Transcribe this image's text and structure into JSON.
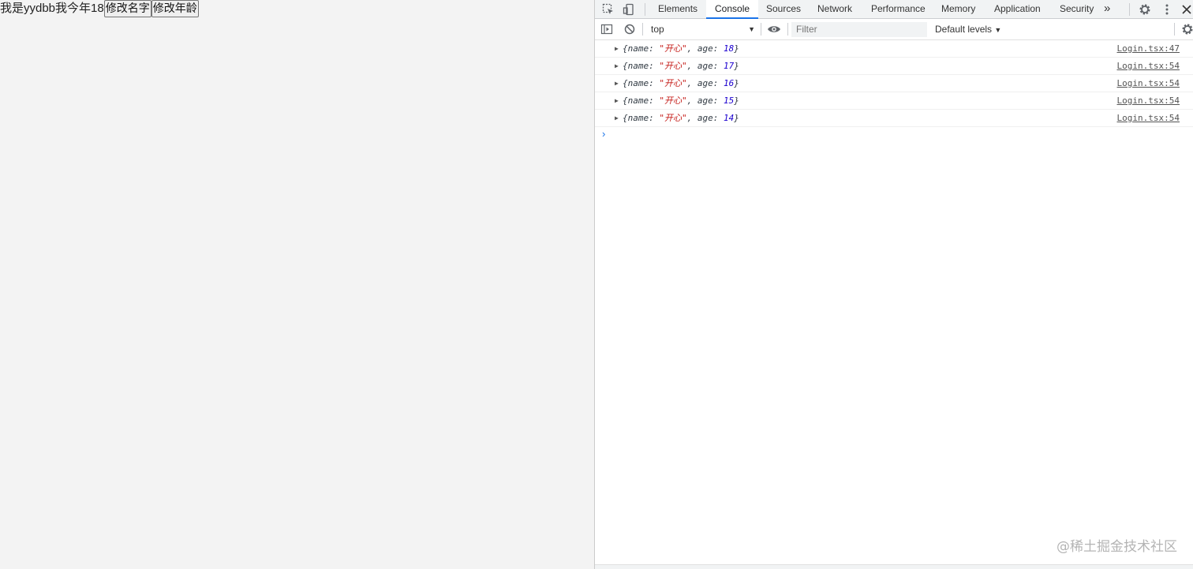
{
  "page": {
    "text": "我是yydbb我今年18",
    "buttons": [
      "修改名字",
      "修改年龄"
    ]
  },
  "devtools": {
    "tabs": [
      "Elements",
      "Console",
      "Sources",
      "Network",
      "Performance",
      "Memory",
      "Application",
      "Security"
    ],
    "active_tab": "Console",
    "more_tabs_icon": "»",
    "icons": [
      "inspect-element-icon",
      "device-toolbar-icon",
      "more-tabs-icon",
      "settings-gear-icon",
      "kebab-menu-icon",
      "close-icon",
      "sidebar-toggle-icon",
      "clear-console-icon",
      "eye-icon"
    ],
    "toolbar": {
      "context": "top",
      "filter_placeholder": "Filter",
      "levels": "Default levels"
    },
    "messages": [
      {
        "prefix": "{name: ",
        "name": "\"开心\"",
        "mid": ", age: ",
        "age": "18",
        "suffix": "}",
        "source": "Login.tsx:47"
      },
      {
        "prefix": "{name: ",
        "name": "\"开心\"",
        "mid": ", age: ",
        "age": "17",
        "suffix": "}",
        "source": "Login.tsx:54"
      },
      {
        "prefix": "{name: ",
        "name": "\"开心\"",
        "mid": ", age: ",
        "age": "16",
        "suffix": "}",
        "source": "Login.tsx:54"
      },
      {
        "prefix": "{name: ",
        "name": "\"开心\"",
        "mid": ", age: ",
        "age": "15",
        "suffix": "}",
        "source": "Login.tsx:54"
      },
      {
        "prefix": "{name: ",
        "name": "\"开心\"",
        "mid": ", age: ",
        "age": "14",
        "suffix": "}",
        "source": "Login.tsx:54"
      }
    ],
    "prompt": "›"
  },
  "watermark": "@稀土掘金技术社区",
  "colors": {
    "accent": "#1a73e8",
    "string": "#c41a16",
    "number": "#1c00cf"
  }
}
